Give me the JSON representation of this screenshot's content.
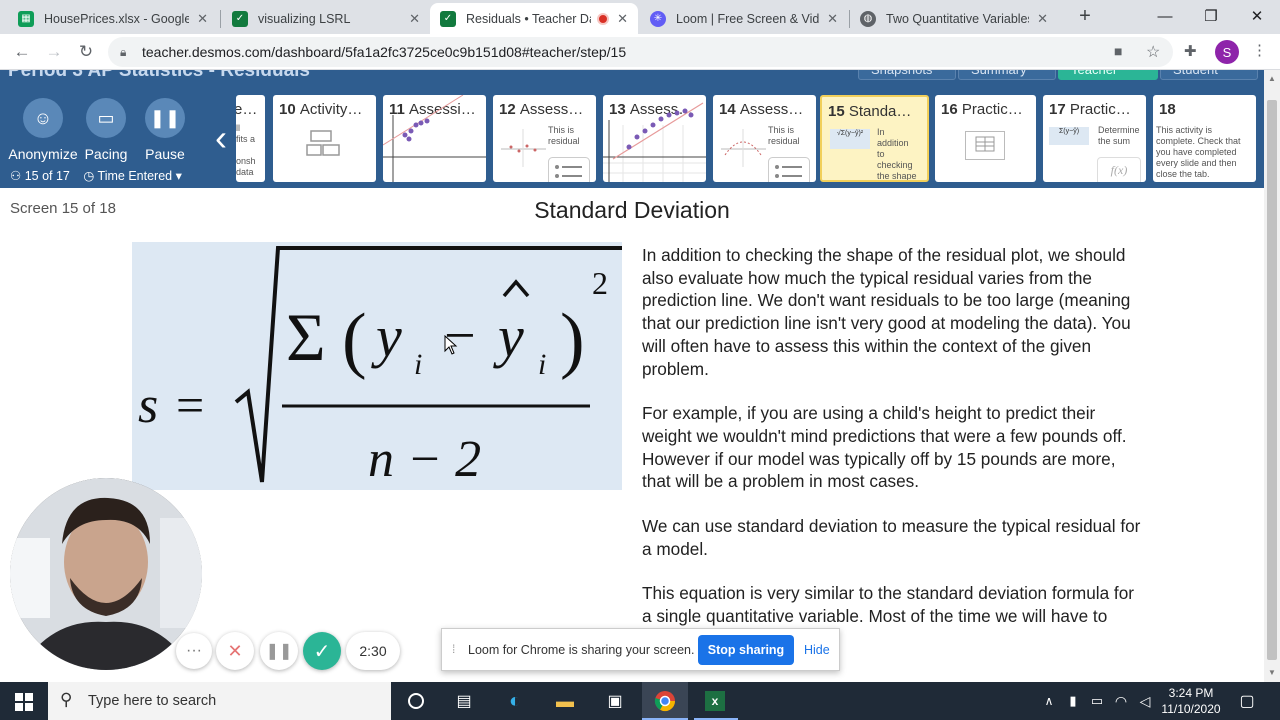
{
  "browser": {
    "tabs": [
      {
        "title": "HousePrices.xlsx - Google S",
        "favicon": "sheets-icon",
        "color": "#0f9d58",
        "active": false
      },
      {
        "title": "visualizing LSRL",
        "favicon": "desmos-icon",
        "color": "#127a3e",
        "active": false
      },
      {
        "title": "Residuals • Teacher Das",
        "favicon": "desmos-icon",
        "color": "#127a3e",
        "active": true,
        "recording": true
      },
      {
        "title": "Loom | Free Screen & Video",
        "favicon": "loom-icon",
        "color": "#625df5",
        "active": false
      },
      {
        "title": "Two Quantitative Variables",
        "favicon": "globe-icon",
        "color": "#5f6368",
        "active": false
      }
    ],
    "new_tab": "+",
    "url": "teacher.desmos.com/dashboard/5fa1a2fc3725ce0c9b151d08#teacher/step/15",
    "profile_initial": "S",
    "profile_color": "#8e24aa"
  },
  "desmos": {
    "header_title": "Period 3 AP Statistics - Residuals",
    "header_tabs": [
      "Snapshots",
      "Summary",
      "Teacher",
      "Student"
    ],
    "controls": [
      {
        "label": "Anonymize",
        "icon": "anonymize-icon"
      },
      {
        "label": "Pacing",
        "icon": "pacing-icon"
      },
      {
        "label": "Pause",
        "icon": "pause-icon"
      }
    ],
    "student_count": "15 of 17",
    "sort_label": "Time Entered",
    "cards": [
      {
        "num": "9",
        "title": "",
        "snippet": "ll\nfits a\n\nonsh\ndata"
      },
      {
        "num": "10",
        "title": "Activity…",
        "snippet": ""
      },
      {
        "num": "11",
        "title": "Assessi…",
        "snippet": ""
      },
      {
        "num": "12",
        "title": "Assess…",
        "snippet": "This is\nresidual"
      },
      {
        "num": "13",
        "title": "Assess…",
        "snippet": ""
      },
      {
        "num": "14",
        "title": "Assess…",
        "snippet": "This is\nresidual"
      },
      {
        "num": "15",
        "title": "Standa…",
        "snippet": "In\naddition\nto\nchecking\nthe shape",
        "selected": true
      },
      {
        "num": "16",
        "title": "Practic…",
        "snippet": ""
      },
      {
        "num": "17",
        "title": "Practic…",
        "snippet": "Determine\nthe sum"
      },
      {
        "num": "18",
        "title": "",
        "snippet": "This activity is\ncomplete. Check that\nyou have completed\nevery slide and then\nclose the tab."
      }
    ],
    "card_fx": "f(x)",
    "screen_label": "Screen 15 of 18",
    "screen_title": "Standard Deviation",
    "formula": {
      "lhs": "s",
      "eq": "=",
      "sigma": "Σ",
      "y": "y",
      "i": "i",
      "minus": "−",
      "denominator": "n − 2",
      "exponent": "2"
    },
    "paragraphs": [
      "In addition to checking the shape of the residual plot, we should also evaluate how much the typical residual varies from the prediction line. We don't want residuals to be too large (meaning that our prediction line isn't very good at modeling the data). You will often have to assess this within the context of the given problem.",
      "For example, if you are using a child's height to predict their weight we wouldn't mind predictions that were a few pounds off. However if our model was typically off by 15 pounds are more, that will be a problem in most cases.",
      "We can use standard deviation to measure the typical residual for a model.",
      "This equation is very similar to the standard deviation formula for a single quantitative variable. Most of the time we will have to calculate this by hand."
    ]
  },
  "loom": {
    "timer": "2:30",
    "share_message": "Loom for Chrome is sharing your screen.",
    "stop_label": "Stop sharing",
    "hide_label": "Hide"
  },
  "taskbar": {
    "search_placeholder": "Type here to search",
    "time": "3:24 PM",
    "date": "11/10/2020"
  }
}
